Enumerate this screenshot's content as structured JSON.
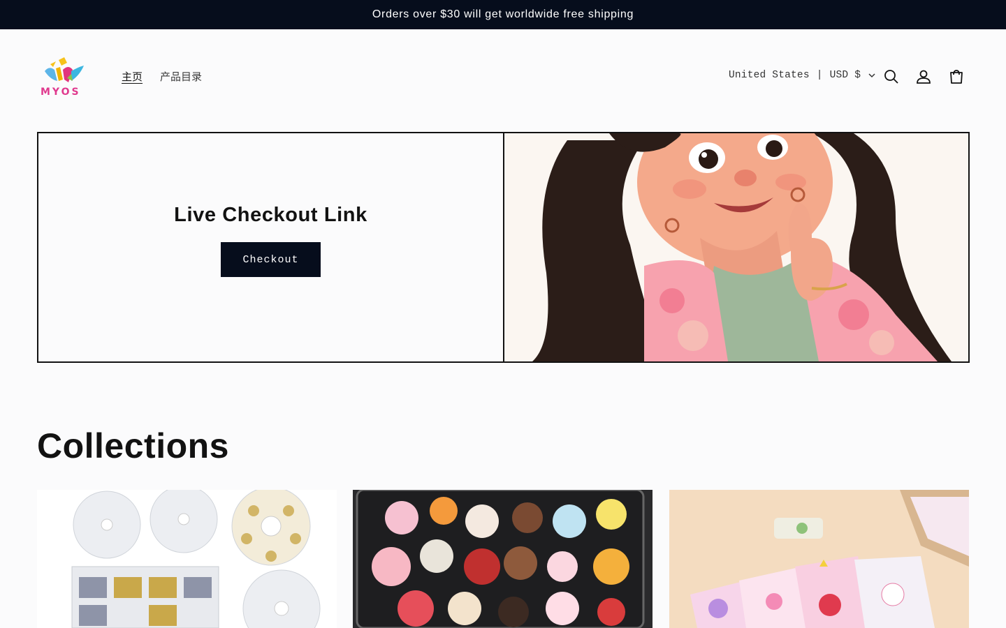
{
  "announcement": {
    "text": "Orders over $30 will get worldwide free shipping"
  },
  "header": {
    "logo_text": "MYOS",
    "nav": [
      {
        "label": "主页",
        "active": true
      },
      {
        "label": "产品目录",
        "active": false
      }
    ],
    "locale": {
      "country": "United States",
      "separator": "|",
      "currency": "USD $"
    },
    "icons": [
      "search-icon",
      "account-icon",
      "cart-icon"
    ]
  },
  "banner": {
    "title": "Live Checkout Link",
    "button_label": "Checkout"
  },
  "collections": {
    "title": "Collections",
    "cards": [
      {
        "image": "jewelry-findings-boxes"
      },
      {
        "image": "acrylic-cartoon-pins"
      },
      {
        "image": "cute-sticker-packs"
      }
    ]
  },
  "colors": {
    "dark": "#060d1c",
    "background": "#fbfbfc",
    "text": "#121212"
  }
}
